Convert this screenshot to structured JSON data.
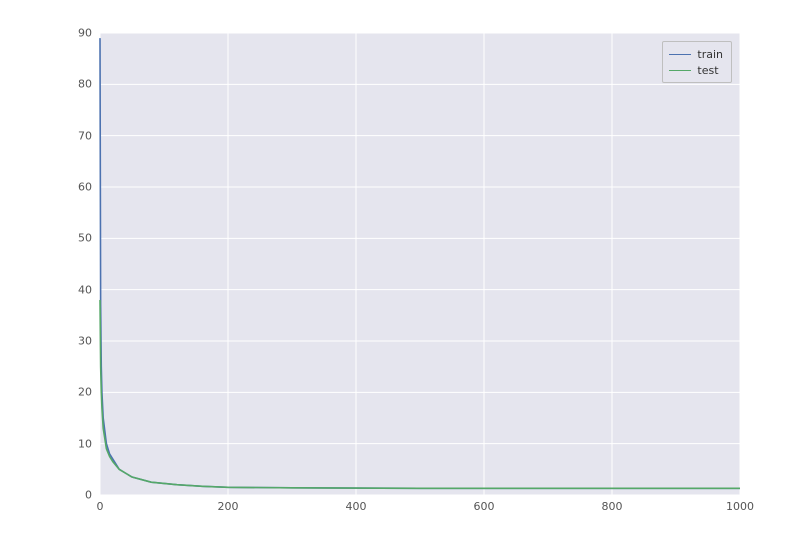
{
  "chart_data": {
    "type": "line",
    "title": "",
    "xlabel": "",
    "ylabel": "",
    "xlim": [
      0,
      1000
    ],
    "ylim": [
      0,
      90
    ],
    "x_ticks": [
      0,
      200,
      400,
      600,
      800,
      1000
    ],
    "y_ticks": [
      0,
      10,
      20,
      30,
      40,
      50,
      60,
      70,
      80,
      90
    ],
    "legend_position": "upper right",
    "series": [
      {
        "name": "train",
        "color": "#4C72B0",
        "x": [
          0,
          1,
          2,
          3,
          5,
          10,
          15,
          20,
          30,
          50,
          80,
          120,
          160,
          200,
          300,
          500,
          700,
          1000
        ],
        "values": [
          89,
          37,
          25,
          20,
          15,
          10,
          8,
          7,
          5,
          3.5,
          2.5,
          2.0,
          1.7,
          1.5,
          1.4,
          1.3,
          1.3,
          1.3
        ]
      },
      {
        "name": "test",
        "color": "#55A868",
        "x": [
          0,
          1,
          2,
          3,
          5,
          10,
          15,
          20,
          30,
          50,
          80,
          120,
          160,
          200,
          300,
          500,
          700,
          1000
        ],
        "values": [
          38,
          25,
          20,
          17,
          13,
          9,
          7.5,
          6.5,
          5,
          3.5,
          2.5,
          2.0,
          1.7,
          1.5,
          1.4,
          1.3,
          1.3,
          1.3
        ]
      }
    ]
  },
  "ticks": {
    "x": [
      "0",
      "200",
      "400",
      "600",
      "800",
      "1000"
    ],
    "y": [
      "0",
      "10",
      "20",
      "30",
      "40",
      "50",
      "60",
      "70",
      "80",
      "90"
    ]
  },
  "legend": {
    "train": "train",
    "test": "test"
  }
}
